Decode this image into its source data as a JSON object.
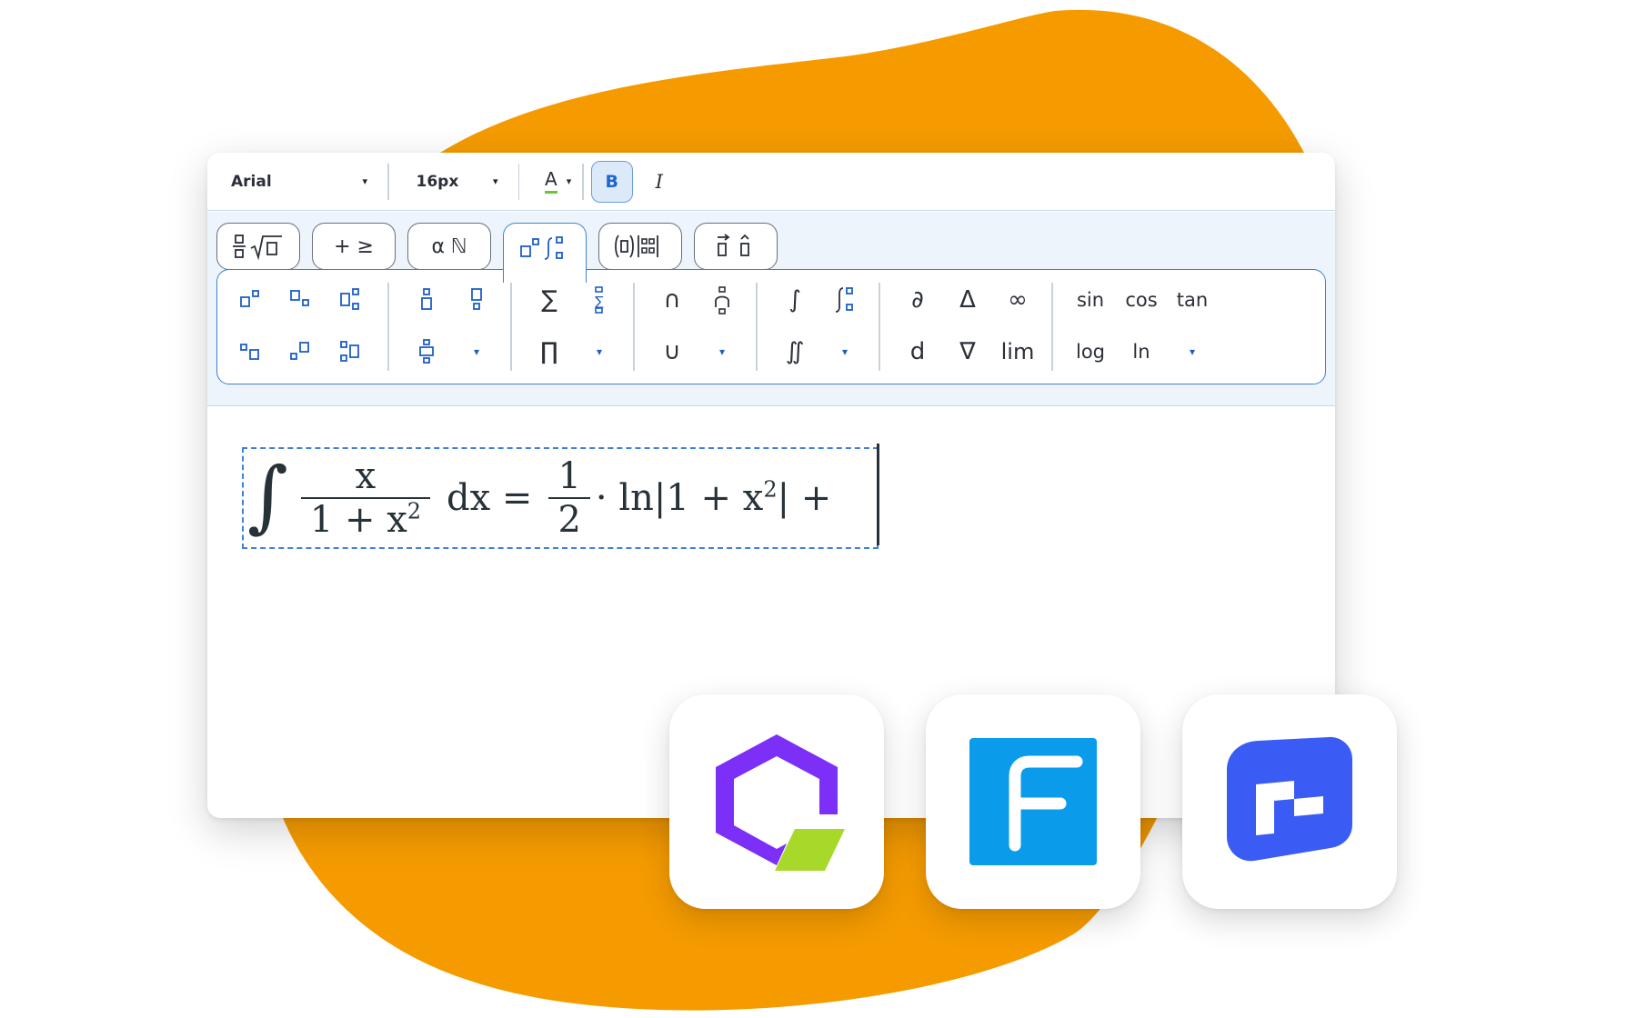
{
  "colors": {
    "blob": "#F59B00",
    "accent": "#3F7FD6",
    "bold_active_bg": "#DBE9F8",
    "text_color_underline": "#6CC33A"
  },
  "toolbar": {
    "font": {
      "value": "Arial",
      "caret": "▾"
    },
    "size": {
      "value": "16px",
      "caret": "▾"
    },
    "text_color": {
      "glyph": "A",
      "caret": "▾"
    },
    "bold": "B",
    "italic": "I"
  },
  "tabs": [
    {
      "name": "fractions-roots",
      "label": "",
      "icon": "fraction-sqrt-icon"
    },
    {
      "name": "operators",
      "label": "+ ≥"
    },
    {
      "name": "symbols",
      "label": "α ℕ"
    },
    {
      "name": "scripts-integrals",
      "label": "",
      "icon": "scripts-integral-icon",
      "active": true
    },
    {
      "name": "brackets-matrix",
      "label": "",
      "icon": "bracket-matrix-icon"
    },
    {
      "name": "accents",
      "label": "",
      "icon": "vector-hat-icon"
    }
  ],
  "palette": {
    "sum": "∑",
    "product": "∏",
    "intersection": "∩",
    "union": "∪",
    "integral": "∫",
    "double_integral": "∬",
    "partial": "∂",
    "delta": "Δ",
    "infinity": "∞",
    "differential": "d",
    "nabla": "∇",
    "lim": "lim",
    "sin": "sin",
    "cos": "cos",
    "tan": "tan",
    "log": "log",
    "ln": "ln",
    "caret": "▾"
  },
  "formula": {
    "integral": "∫",
    "num": "x",
    "den_base": "1 + x",
    "den_exp": "2",
    "dx_eq": "dx =",
    "half_num": "1",
    "half_den": "2",
    "ln_part": "· ln|1 + x",
    "ln_exp": "2",
    "tail": "| +"
  },
  "apps": [
    {
      "name": "purple-hexagon-app"
    },
    {
      "name": "blue-f-app"
    },
    {
      "name": "blue-square-app"
    }
  ]
}
